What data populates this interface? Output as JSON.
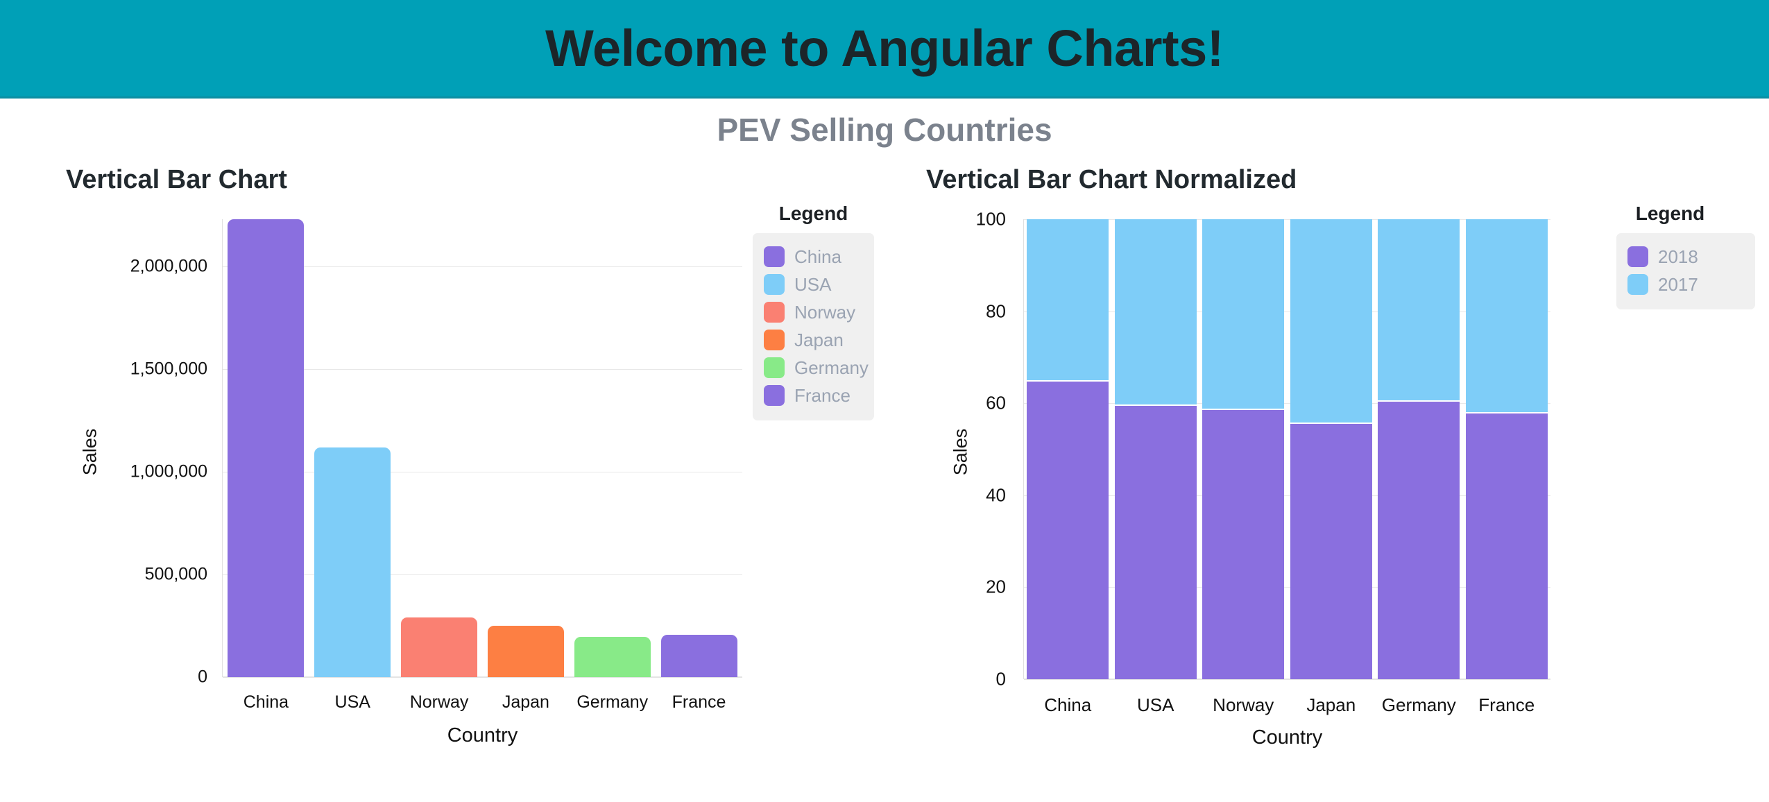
{
  "header": {
    "title": "Welcome to Angular Charts!",
    "background_color": "#00a0b7"
  },
  "page": {
    "subtitle": "PEV Selling Countries"
  },
  "left_chart": {
    "title": "Vertical Bar Chart",
    "legend_title": "Legend",
    "legend_items": [
      {
        "label": "China",
        "color": "#8a6fdf"
      },
      {
        "label": "USA",
        "color": "#7ecdf8"
      },
      {
        "label": "Norway",
        "color": "#fa8072"
      },
      {
        "label": "Japan",
        "color": "#fd7f43"
      },
      {
        "label": "Germany",
        "color": "#88ea88"
      },
      {
        "label": "France",
        "color": "#8a6fdf"
      }
    ]
  },
  "right_chart": {
    "title": "Vertical Bar Chart Normalized",
    "legend_title": "Legend",
    "legend_items": [
      {
        "label": "2018",
        "color": "#8a6fdf"
      },
      {
        "label": "2017",
        "color": "#7ecdf8"
      }
    ]
  },
  "chart_data": [
    {
      "type": "bar",
      "title": "Vertical Bar Chart",
      "xlabel": "Country",
      "ylabel": "Sales",
      "categories": [
        "China",
        "USA",
        "Norway",
        "Japan",
        "Germany",
        "France"
      ],
      "values": [
        2230000,
        1120000,
        290000,
        250000,
        195000,
        205000
      ],
      "colors": [
        "#8a6fdf",
        "#7ecdf8",
        "#fa8072",
        "#fd7f43",
        "#88ea88",
        "#8a6fdf"
      ],
      "ylim": [
        0,
        2230000
      ],
      "yticks": [
        0,
        500000,
        1000000,
        1500000,
        2000000
      ],
      "ytick_labels": [
        "0",
        "500,000",
        "1,000,000",
        "1,500,000",
        "2,000,000"
      ],
      "grid": true,
      "legend_position": "right"
    },
    {
      "type": "bar",
      "subtype": "stacked-normalized",
      "title": "Vertical Bar Chart Normalized",
      "xlabel": "Country",
      "ylabel": "Sales",
      "categories": [
        "China",
        "USA",
        "Norway",
        "Japan",
        "Germany",
        "France"
      ],
      "series": [
        {
          "name": "2018",
          "color": "#8a6fdf",
          "values": [
            64.7,
            59.4,
            58.5,
            55.5,
            60.3,
            57.8
          ]
        },
        {
          "name": "2017",
          "color": "#7ecdf8",
          "values": [
            35.3,
            40.6,
            41.5,
            44.5,
            39.7,
            42.2
          ]
        }
      ],
      "ylim": [
        0,
        100
      ],
      "yticks": [
        0,
        20,
        40,
        60,
        80,
        100
      ],
      "ytick_labels": [
        "0",
        "20",
        "40",
        "60",
        "80",
        "100"
      ],
      "grid": true,
      "legend_position": "right"
    }
  ]
}
